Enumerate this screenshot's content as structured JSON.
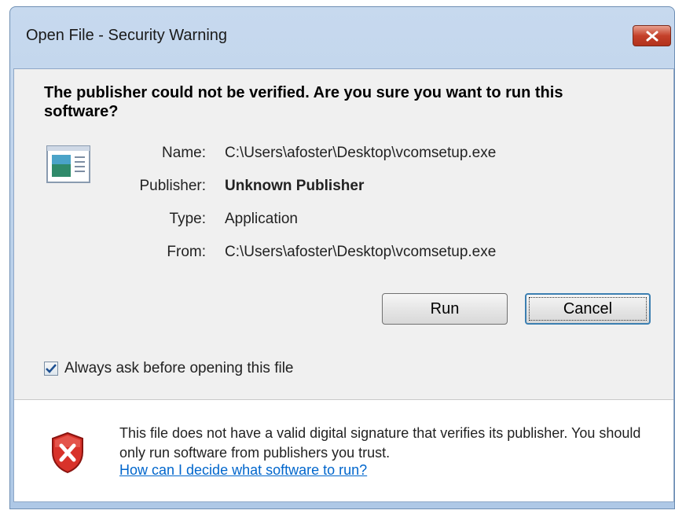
{
  "window": {
    "title": "Open File - Security Warning",
    "close_label": "close"
  },
  "dialog": {
    "heading": "The publisher could not be verified.  Are you sure you want to run this software?",
    "icon": "application-file-icon",
    "fields": [
      {
        "label": "Name:",
        "value": "C:\\Users\\afoster\\Desktop\\vcomsetup.exe"
      },
      {
        "label": "Publisher:",
        "value": "Unknown Publisher"
      },
      {
        "label": "Type:",
        "value": "Application"
      },
      {
        "label": "From:",
        "value": "C:\\Users\\afoster\\Desktop\\vcomsetup.exe"
      }
    ],
    "buttons": {
      "run": "Run",
      "cancel": "Cancel"
    },
    "checkbox": {
      "label": "Always ask before opening this file",
      "checked": true
    }
  },
  "warning": {
    "icon": "shield-error-icon",
    "text": "This file does not have a valid digital signature that verifies its publisher.  You should only run software from publishers you trust.",
    "link": "How can I decide what software to run?"
  },
  "colors": {
    "title_bar": "#c7d9ee",
    "close_button": "#c4402a",
    "link": "#0066cc",
    "focus_border": "#3c7fb1"
  }
}
